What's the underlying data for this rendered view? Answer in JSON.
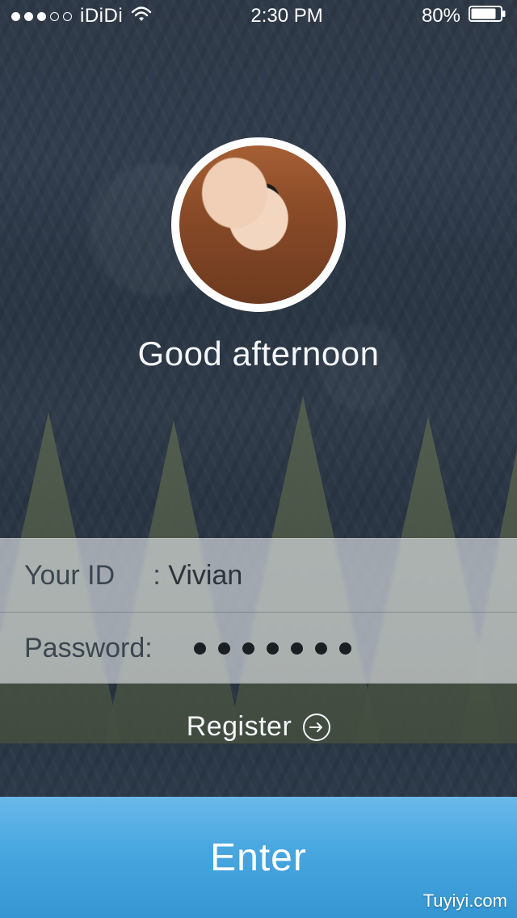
{
  "status_bar": {
    "carrier": "iDiDi",
    "time": "2:30 PM",
    "battery_pct": "80%",
    "signal_strength_of_5": 3
  },
  "greeting": "Good afternoon",
  "form": {
    "id_label": "Your ID     : ",
    "id_value": "Vivian",
    "password_label": "Password: ",
    "password_dot_count": 7
  },
  "register": {
    "label": "Register"
  },
  "enter_button": {
    "label": "Enter"
  },
  "watermark": "Tuyiyi.com",
  "colors": {
    "accent_blue": "#3fa0db",
    "panel_bg": "rgba(232,236,240,0.62)",
    "text_dark": "#2c333a"
  },
  "icons": {
    "wifi": "wifi-icon",
    "battery": "battery-icon",
    "register_arrow": "arrow-right-circle-icon"
  }
}
